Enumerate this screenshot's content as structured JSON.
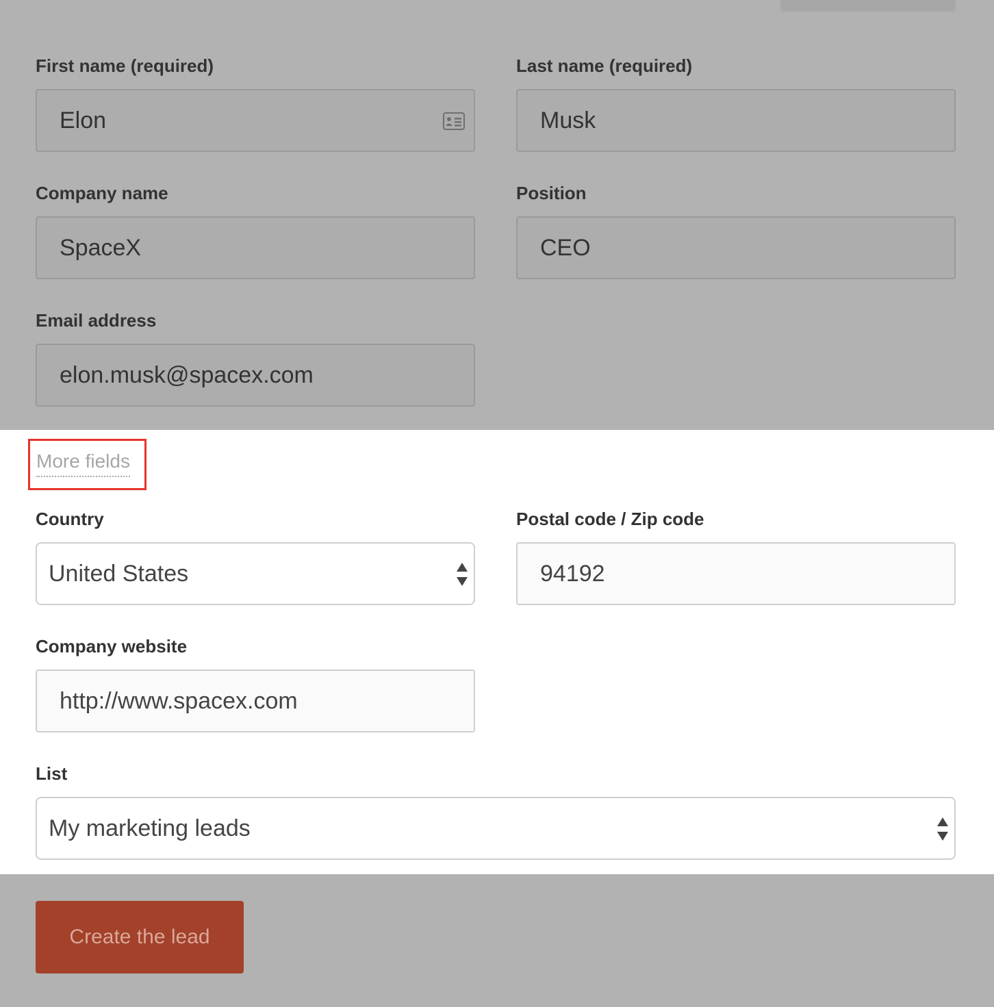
{
  "form": {
    "first_name": {
      "label": "First name (required)",
      "value": "Elon",
      "icon": "contact-card-icon"
    },
    "last_name": {
      "label": "Last name (required)",
      "value": "Musk"
    },
    "company_name": {
      "label": "Company name",
      "value": "SpaceX"
    },
    "position": {
      "label": "Position",
      "value": "CEO"
    },
    "email": {
      "label": "Email address",
      "value": "elon.musk@spacex.com"
    }
  },
  "more_fields": {
    "link_label": "More fields",
    "highlight_color": "#e8332b",
    "country": {
      "label": "Country",
      "selected": "United States",
      "icon": "select-arrows-icon"
    },
    "postal_code": {
      "label": "Postal code / Zip code",
      "value": "94192"
    },
    "company_website": {
      "label": "Company website",
      "value": "http://www.spacex.com"
    },
    "list": {
      "label": "List",
      "selected": "My marketing leads",
      "icon": "select-arrows-icon"
    }
  },
  "actions": {
    "create_label": "Create the lead",
    "create_color": "#a3412a"
  },
  "overlay_color": "#b2b2b2"
}
